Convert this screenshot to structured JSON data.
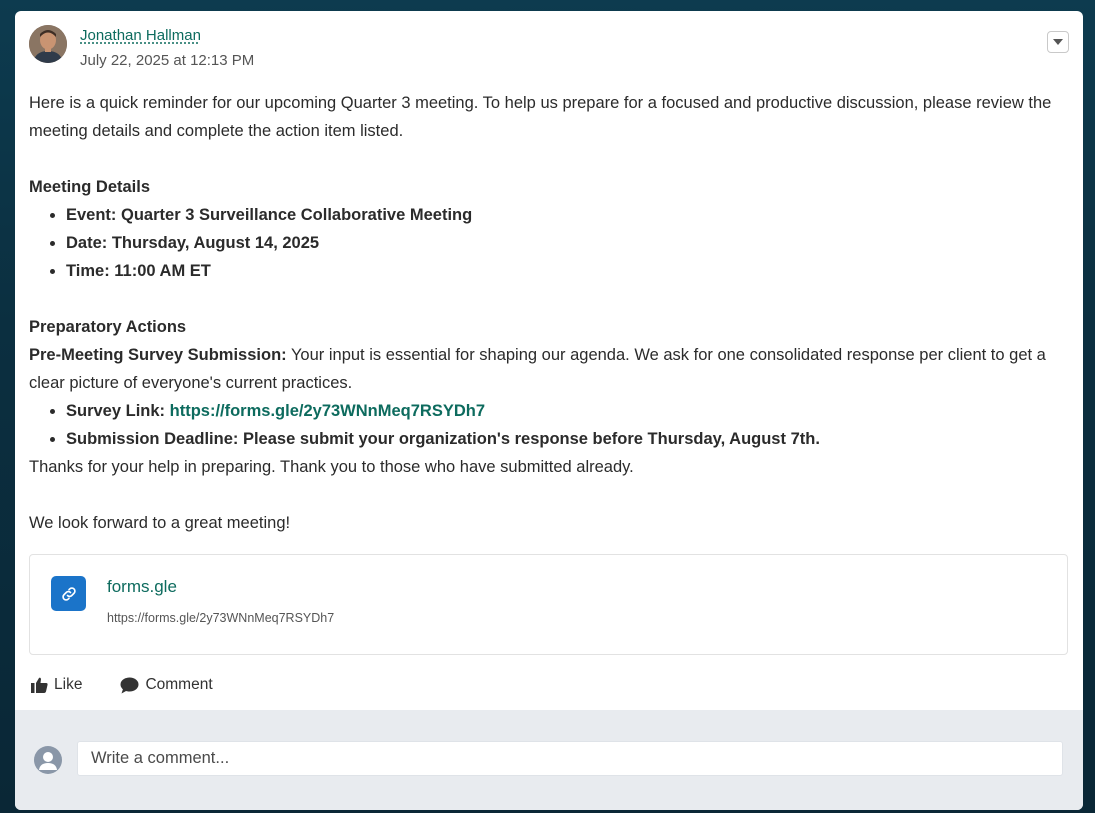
{
  "post": {
    "author": "Jonathan Hallman",
    "timestamp": "July 22, 2025 at 12:13 PM",
    "menu_icon": "chevron-down-icon",
    "intro": "Here is a quick reminder for our upcoming Quarter 3 meeting. To help us prepare for a focused and productive discussion, please review the meeting details and complete the action item listed.",
    "meeting_heading": "Meeting Details",
    "meeting_items": [
      "Event: Quarter 3 Surveillance Collaborative Meeting",
      "Date: Thursday, August 14, 2025",
      "Time: 11:00 AM ET"
    ],
    "prep_heading": "Preparatory Actions",
    "survey_label": "Pre-Meeting Survey Submission:",
    "survey_text": " Your input is essential for shaping our agenda. We ask for one consolidated response per client to get a clear picture of everyone's current practices.",
    "survey_link_label": "Survey Link: ",
    "survey_link": "https://forms.gle/2y73WNnMeq7RSYDh7",
    "deadline": "Submission Deadline: Please submit your organization's response before Thursday, August 7th.",
    "thanks": "Thanks for your help in preparing. Thank you to those who have submitted already.",
    "closing": "We look forward to a great meeting!"
  },
  "link_preview": {
    "domain": "forms.gle",
    "url": "https://forms.gle/2y73WNnMeq7RSYDh7",
    "icon": "link-icon",
    "icon_color": "#1b74c9"
  },
  "actions": {
    "like_label": "Like",
    "comment_label": "Comment"
  },
  "comment": {
    "placeholder": "Write a comment..."
  },
  "colors": {
    "link": "#0d6b5e",
    "background": "#0b2f40",
    "comment_area": "#e8ebef"
  }
}
